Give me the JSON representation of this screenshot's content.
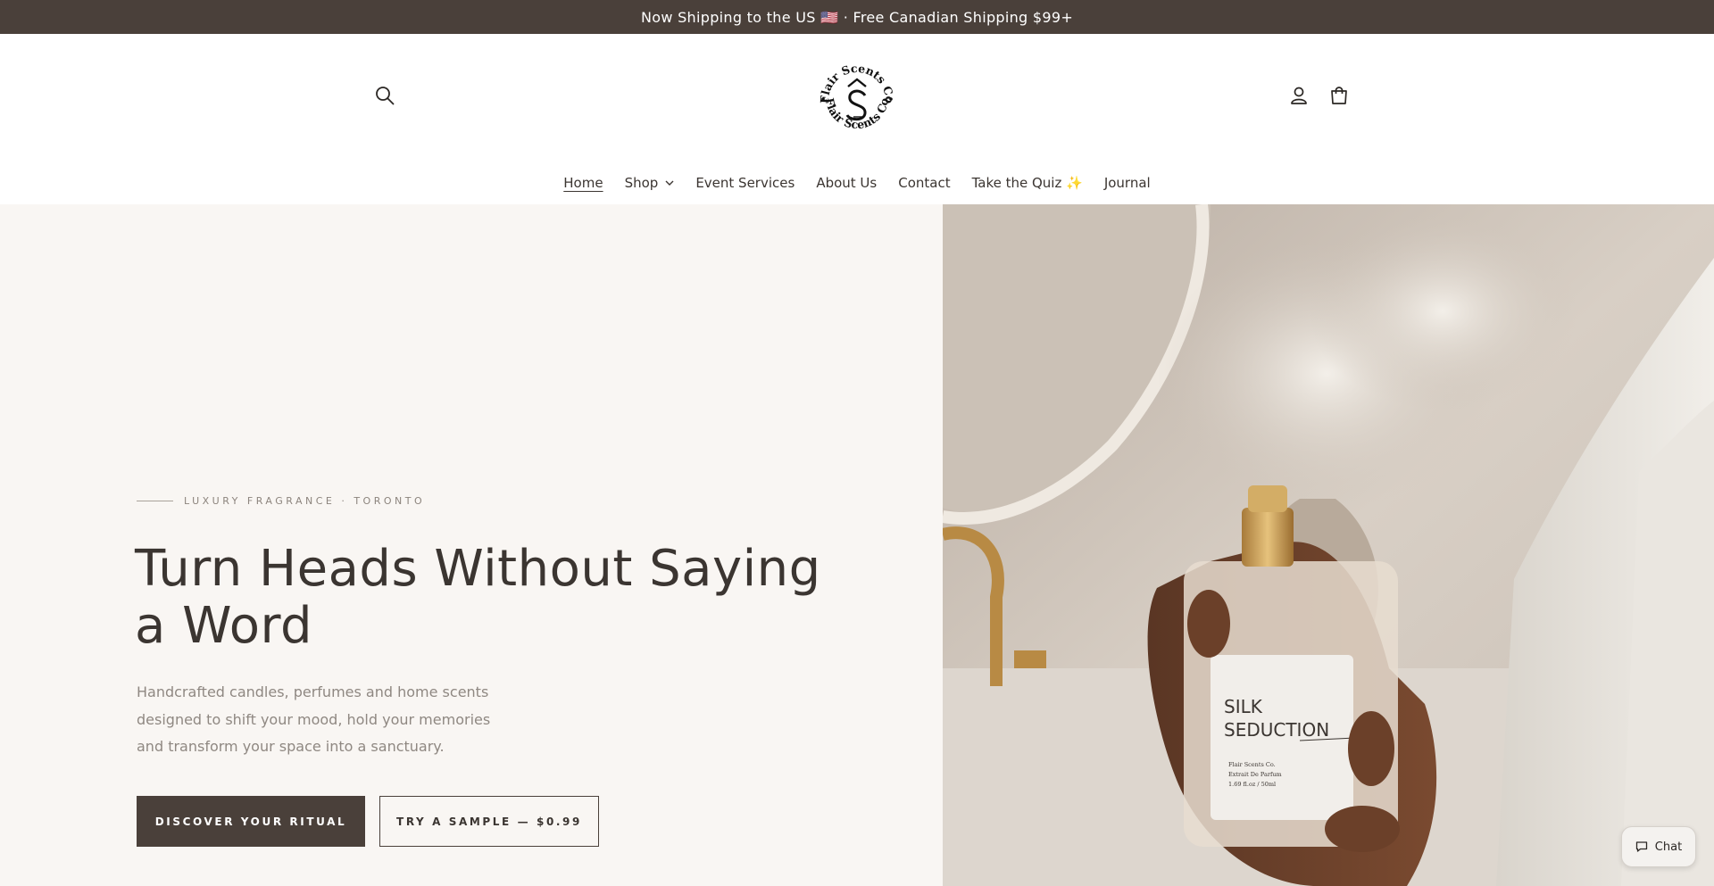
{
  "announcement": {
    "text": "Now Shipping to the US 🇺🇸 · Free Canadian Shipping $99+"
  },
  "header": {
    "logo": {
      "text_top": "Flair Scents Co",
      "text_bottom": "Flair Scents Co"
    },
    "icons": {
      "search": "search-icon",
      "account": "user-icon",
      "cart": "bag-icon"
    }
  },
  "nav": {
    "items": [
      {
        "label": "Home",
        "active": true
      },
      {
        "label": "Shop",
        "has_dropdown": true
      },
      {
        "label": "Event Services"
      },
      {
        "label": "About Us"
      },
      {
        "label": "Contact"
      },
      {
        "label": "Take the Quiz ✨"
      },
      {
        "label": "Journal"
      }
    ]
  },
  "hero": {
    "eyebrow": "LUXURY FRAGRANCE · TORONTO",
    "headline_line1": "Turn Heads Without Saying",
    "headline_line2": "a Word",
    "subtext": "Handcrafted candles, perfumes and home scents designed to shift your mood, hold your memories and transform your space into a sanctuary.",
    "primary_cta": "DISCOVER YOUR RITUAL",
    "secondary_cta": "TRY A SAMPLE — $0.99",
    "image": {
      "label_line1": "SILK",
      "label_line2": "SEDUCTION",
      "small_line1": "Flair Scents Co.",
      "small_line2": "Extrait De Parfum",
      "small_line3": "1.69 fl.oz / 50ml"
    }
  },
  "chat": {
    "label": "Chat"
  },
  "colors": {
    "dark": "#4a403a",
    "hero_bg": "#f9f6f3",
    "text": "#3b3531",
    "muted": "#8f8882"
  }
}
